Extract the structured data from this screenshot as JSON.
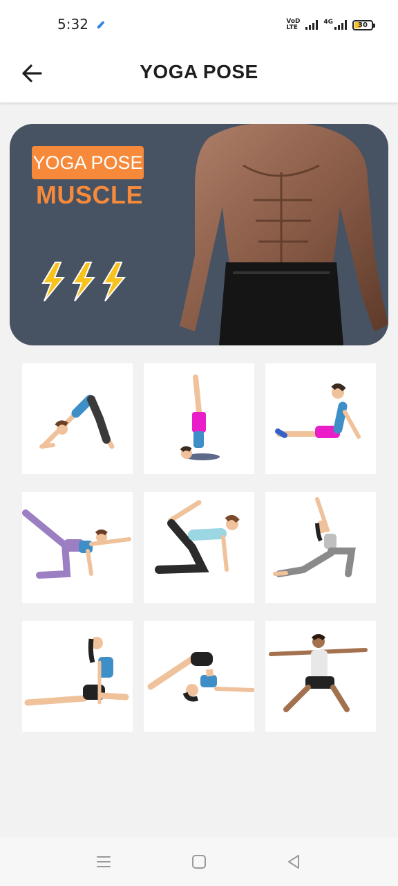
{
  "status_bar": {
    "time": "5:32",
    "network_label": "4G",
    "volte_label": "VoD LTE",
    "battery_level": "30",
    "icons": [
      "app-notification-icon",
      "volte-icon",
      "signal-icon",
      "signal-4g-icon",
      "battery-icon"
    ]
  },
  "app_bar": {
    "title": "YOGA POSE",
    "back_icon": "arrow-left-icon"
  },
  "banner": {
    "tag_label": "YOGA POSE",
    "heading": "MUSCLE",
    "accent_color": "#f68a3a",
    "background_color": "#475263",
    "decoration": [
      "lightning-bolt-icon",
      "lightning-bolt-icon",
      "lightning-bolt-icon"
    ]
  },
  "poses": [
    {
      "name": "downward-dog-pose"
    },
    {
      "name": "shoulder-stand-pose"
    },
    {
      "name": "cobra-pose"
    },
    {
      "name": "bird-dog-pose"
    },
    {
      "name": "donkey-kick-pose"
    },
    {
      "name": "crescent-lunge-pose"
    },
    {
      "name": "pigeon-pose"
    },
    {
      "name": "plow-pose"
    },
    {
      "name": "warrior-two-pose"
    }
  ],
  "nav_bar": {
    "icons": [
      "menu-icon",
      "home-square-icon",
      "back-triangle-icon"
    ]
  }
}
